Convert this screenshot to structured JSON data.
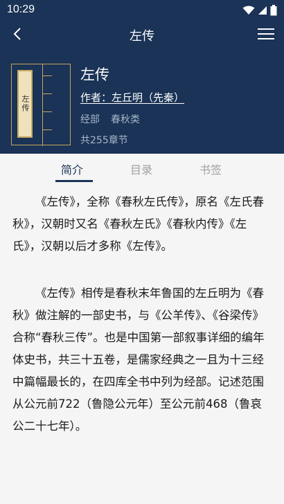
{
  "status_bar": {
    "time": "10:29",
    "icons": [
      "wifi-icon",
      "signal-icon",
      "battery-icon"
    ]
  },
  "app_bar": {
    "title": "左传",
    "back_icon": "chevron-left-icon",
    "menu_icon": "hamburger-menu-icon"
  },
  "book": {
    "cover_title": "左传",
    "title": "左传",
    "author": "作者：左丘明（先秦）",
    "category": "经部",
    "subcategory": "春秋类",
    "chapters": "共255章节"
  },
  "tabs": [
    {
      "label": "简介",
      "active": true
    },
    {
      "label": "目录",
      "active": false
    },
    {
      "label": "书签",
      "active": false
    }
  ],
  "intro": {
    "paragraphs": [
      "《左传》，全称《春秋左氏传》，原名《左氏春秋》，汉朝时又名《春秋左氏》《春秋内传》《左氏》，汉朝以后才多称《左传》。",
      "《左传》相传是春秋末年鲁国的左丘明为《春秋》做注解的一部史书，与《公羊传》、《谷梁传》合称“春秋三传”。也是中国第一部叙事详细的编年体史书，共三十五卷，是儒家经典之一且为十三经中篇幅最长的，在四库全书中列为经部。记述范围从公元前722（鲁隐公元年）至公元前468（鲁哀公二十七年）。"
    ]
  },
  "colors": {
    "primary": "#1a3356",
    "accent_gold": "#c7a85e",
    "muted_text": "#a8b6c8",
    "inactive_tab": "#a0a0a0",
    "background": "#f5f5f5"
  }
}
